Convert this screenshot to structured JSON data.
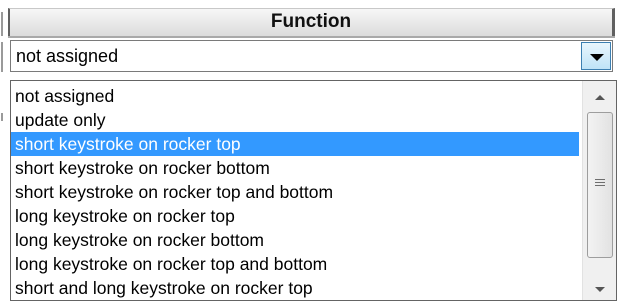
{
  "header": {
    "title": "Function"
  },
  "combo": {
    "value": "not assigned"
  },
  "dropdown": {
    "selected_index": 2,
    "items": [
      "not assigned",
      "update only",
      "short keystroke on rocker top",
      "short keystroke on rocker bottom",
      "short keystroke on rocker top and bottom",
      "long keystroke on rocker top",
      "long keystroke on rocker bottom",
      "long keystroke on rocker top and bottom",
      "short and long keystroke on rocker top"
    ]
  },
  "colors": {
    "selection": "#3399ff",
    "combo_button": "#bfe3f7"
  },
  "icons": {
    "combo_button": "chevron-down-icon",
    "scroll_up": "scroll-up-arrow-icon",
    "scroll_down": "scroll-down-arrow-icon",
    "scroll_grip": "grip-icon"
  }
}
